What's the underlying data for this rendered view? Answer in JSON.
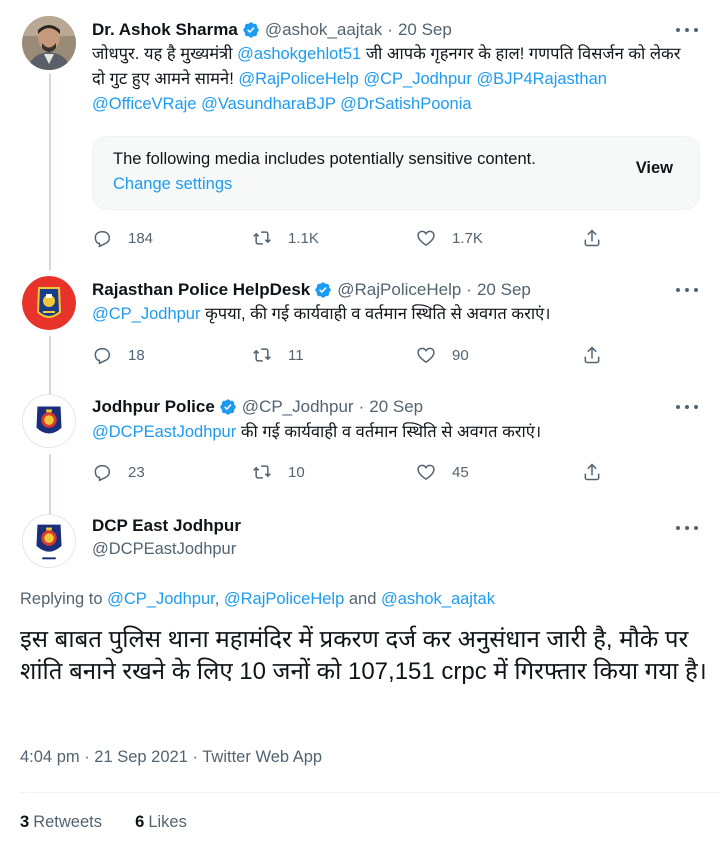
{
  "colors": {
    "link": "#1d9bf0",
    "secondary": "#536471",
    "verified": "#1d9bf0"
  },
  "tweets": [
    {
      "name": "Dr. Ashok Sharma",
      "handle": "@ashok_aajtak",
      "sep": "·",
      "date": "20 Sep",
      "text_parts": [
        "जोधपुर. यह है मुख्यमंत्री ",
        "@ashokgehlot51",
        " जी आपके गृहनगर के हाल! गणपति विसर्जन को लेकर दो गुट हुए आमने सामने! ",
        "@RajPoliceHelp",
        " ",
        "@CP_Jodhpur",
        " ",
        "@BJP4Rajasthan",
        " ",
        "@OfficeVRaje",
        " ",
        "@VasundharaBJP",
        " ",
        "@DrSatishPoonia"
      ],
      "sensitive": {
        "message": "The following media includes potentially sensitive content.",
        "settings_link": "Change settings",
        "view_label": "View"
      },
      "replies": "184",
      "retweets": "1.1K",
      "likes": "1.7K"
    },
    {
      "name": "Rajasthan Police HelpDesk",
      "handle": "@RajPoliceHelp",
      "sep": "·",
      "date": "20 Sep",
      "text_parts": [
        "@CP_Jodhpur",
        " कृपया, की गई कार्यवाही व वर्तमान स्थिति से अवगत कराएं।"
      ],
      "replies": "18",
      "retweets": "11",
      "likes": "90"
    },
    {
      "name": "Jodhpur Police",
      "handle": "@CP_Jodhpur",
      "sep": "·",
      "date": "20 Sep",
      "text_parts": [
        "@DCPEastJodhpur",
        " की गई कार्यवाही व वर्तमान स्थिति से अवगत कराएं।"
      ],
      "replies": "23",
      "retweets": "10",
      "likes": "45"
    }
  ],
  "main_tweet": {
    "name": "DCP East Jodhpur",
    "handle": "@DCPEastJodhpur",
    "replying_prefix": "Replying to ",
    "replying_user1": "@CP_Jodhpur",
    "replying_comma": ", ",
    "replying_user2": "@RajPoliceHelp",
    "replying_and": " and ",
    "replying_user3": "@ashok_aajtak",
    "text": "इस बाबत पुलिस थाना महामंदिर में प्रकरण दर्ज कर अनुसंधान जारी है, मौके पर शांति बनाने रखने के लिए 10 जनों को 107,151 crpc में गिरफ्तार किया गया है।",
    "time": "4:04 pm",
    "sep": " · ",
    "date": "21 Sep 2021",
    "source": "Twitter Web App",
    "retweets_count": "3",
    "retweets_label": "Retweets",
    "likes_count": "6",
    "likes_label": "Likes"
  }
}
